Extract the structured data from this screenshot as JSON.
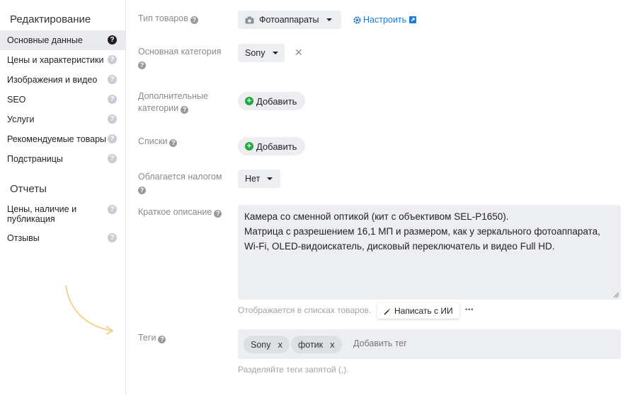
{
  "sidebar": {
    "edit_heading": "Редактирование",
    "reports_heading": "Отчеты",
    "items": [
      {
        "label": "Основные данные"
      },
      {
        "label": "Цены и характеристики"
      },
      {
        "label": "Изображения и видео"
      },
      {
        "label": "SEO"
      },
      {
        "label": "Услуги"
      },
      {
        "label": "Рекомендуемые товары"
      },
      {
        "label": "Подстраницы"
      }
    ],
    "report_items": [
      {
        "label": "Цены, наличие и публикация"
      },
      {
        "label": "Отзывы"
      }
    ]
  },
  "form": {
    "product_type": {
      "label": "Тип товаров",
      "value": "Фотоаппараты",
      "configure": "Настроить"
    },
    "main_category": {
      "label": "Основная категория",
      "value": "Sony"
    },
    "extra_categories": {
      "label": "Дополнительные категории",
      "button": "Добавить"
    },
    "lists": {
      "label": "Списки",
      "button": "Добавить"
    },
    "taxable": {
      "label": "Облагается налогом",
      "value": "Нет"
    },
    "short_description": {
      "label": "Краткое описание",
      "value": "Камера со сменной оптикой (кит с объективом SEL-P1650).\nМатрица с разрешением 16,1 МП и размером, как у зеркального фотоаппарата,\nWi-Fi, OLED-видоискатель, дисковый переключатель и видео Full HD.",
      "hint": "Отображается в списках товаров.",
      "ai_button": "Написать с ИИ",
      "more": "•••"
    },
    "tags": {
      "label": "Теги",
      "items": [
        "Sony",
        "фотик"
      ],
      "placeholder": "Добавить тег",
      "hint": "Разделяйте теги запятой (,)."
    }
  },
  "colors": {
    "accent": "#1a7bd6",
    "add_green": "#22a83c",
    "field_bg": "#eceef1",
    "annotation_arrow": "#f5c97a"
  }
}
